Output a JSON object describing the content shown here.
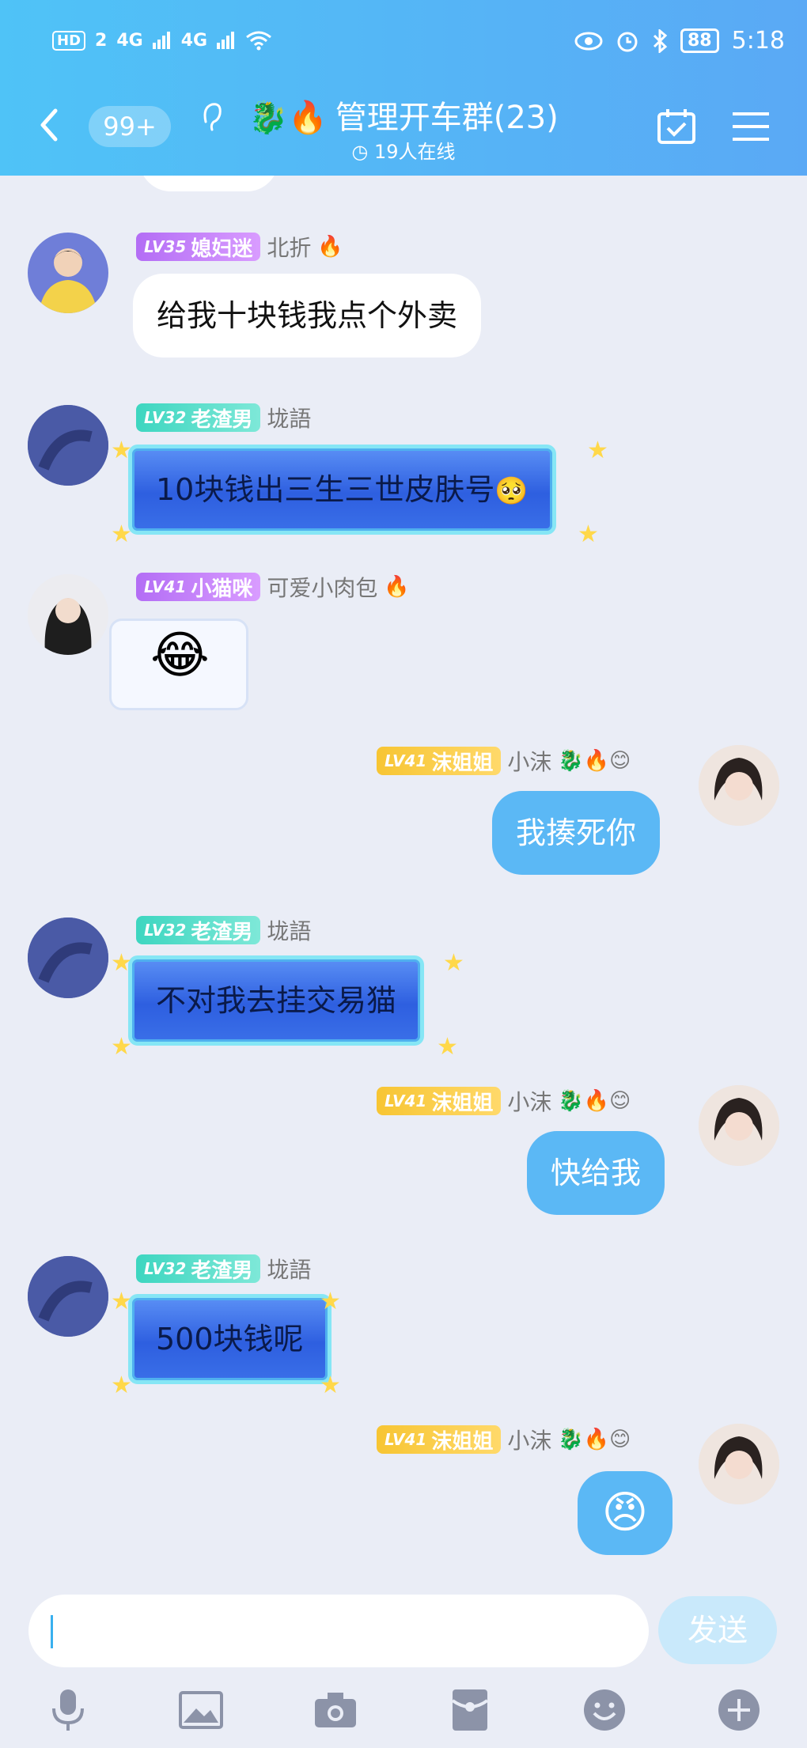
{
  "status_bar": {
    "hd": "HD",
    "sim": "2",
    "signal1": "4G",
    "signal2": "4G",
    "battery": "88",
    "time": "5:18"
  },
  "header": {
    "unread_count": "99+",
    "group_name": "管理开车群(23)",
    "online_text": "19人在线",
    "title_emoji": "🐉🔥"
  },
  "messages": [
    {
      "side": "left",
      "level": "LV35",
      "title": "媳妇迷",
      "name": "北折",
      "name_emoji": "🔥",
      "text": "给我十块钱我点个外卖",
      "style": "white"
    },
    {
      "side": "left",
      "level": "LV32",
      "title": "老渣男",
      "name": "垅語",
      "text": "10块钱出三生三世皮肤号",
      "style": "fancy",
      "trail_emoji": "🥺"
    },
    {
      "side": "left",
      "level": "LV41",
      "title": "小猫咪",
      "name": "可爱小肉包",
      "name_emoji": "🔥",
      "sticker": "😂",
      "style": "sticker"
    },
    {
      "side": "right",
      "level": "LV41",
      "title": "沫姐姐",
      "name": "小沫",
      "name_emoji": "🐉🔥😊",
      "text": "我揍死你",
      "style": "blue"
    },
    {
      "side": "left",
      "level": "LV32",
      "title": "老渣男",
      "name": "垅語",
      "text": "不对我去挂交易猫",
      "style": "fancy"
    },
    {
      "side": "right",
      "level": "LV41",
      "title": "沫姐姐",
      "name": "小沫",
      "name_emoji": "🐉🔥😊",
      "text": "快给我",
      "style": "blue"
    },
    {
      "side": "left",
      "level": "LV32",
      "title": "老渣男",
      "name": "垅語",
      "text": "500块钱呢",
      "style": "fancy"
    },
    {
      "side": "right",
      "level": "LV41",
      "title": "沫姐姐",
      "name": "小沫",
      "name_emoji": "🐉🔥😊",
      "sticker": "😠",
      "style": "blue-sticker"
    }
  ],
  "input": {
    "send_label": "发送"
  },
  "colors": {
    "header_start": "#4fc3f7",
    "header_end": "#5aa9f5",
    "bubble_self": "#5bb8f5",
    "background": "#eaedf6"
  }
}
